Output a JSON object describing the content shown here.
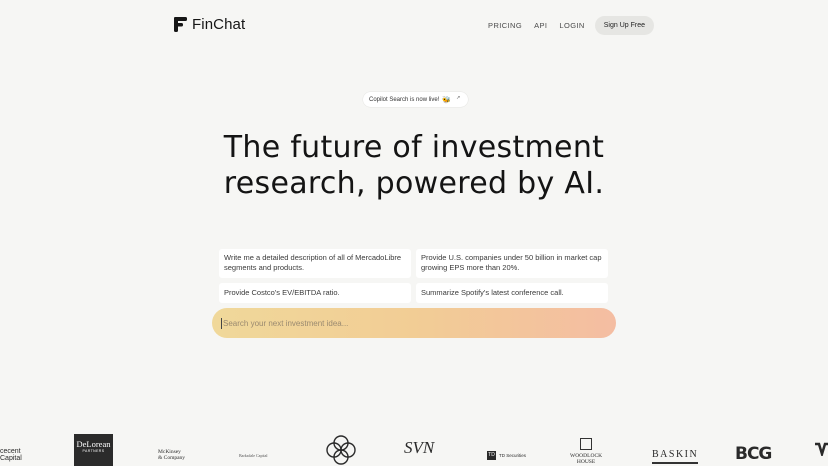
{
  "header": {
    "brand": "FinChat",
    "nav": [
      {
        "label": "PRICING"
      },
      {
        "label": "API"
      },
      {
        "label": "LOGIN"
      }
    ],
    "signup_label": "Sign Up Free"
  },
  "announcement": {
    "text": "Copilot Search is now live!",
    "emoji": "🐝",
    "arrow": "↗"
  },
  "hero": {
    "line1": "The future of investment",
    "line2": "research, powered by AI."
  },
  "suggestions": [
    {
      "text": "Write me a detailed description of all of MercadoLibre segments and products."
    },
    {
      "text": "Provide U.S. companies under 50 billion in market cap growing EPS more than 20%."
    },
    {
      "text": "Provide Costco's EV/EBITDA ratio."
    },
    {
      "text": "Summarize Spotify's latest conference call."
    }
  ],
  "search": {
    "placeholder": "Search your next investment idea..."
  },
  "logos": {
    "l1_line1": "cecent",
    "l1_line2": "Capital",
    "l2_line1": "DeLorean",
    "l2_line2": "PARTNERS",
    "l3_line1": "McKinsey",
    "l3_line2": "& Company",
    "l4": "Barksdale Capital",
    "l6": "SVN",
    "l7_mark": "TD",
    "l7": "TD Securities",
    "l8_line1": "WOODLOCK",
    "l8_line2": "HOUSE",
    "l9": "BASKIN",
    "l10": "BCG"
  },
  "colors": {
    "background": "#f6f6f4",
    "search_gradient_start": "#f0d89a",
    "search_gradient_end": "#f4bda2"
  }
}
